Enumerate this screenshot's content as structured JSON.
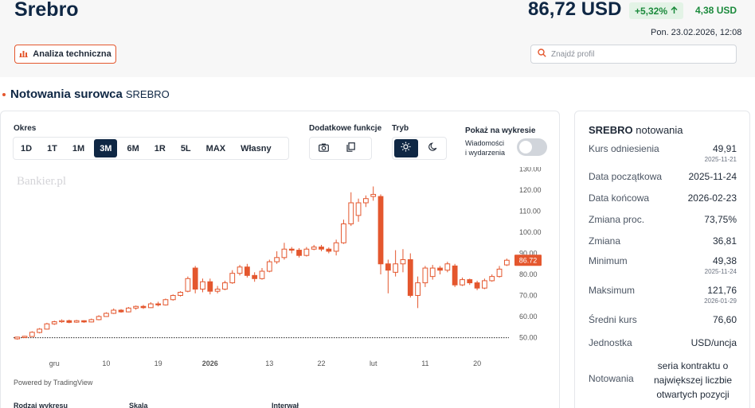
{
  "header": {
    "title": "Srebro",
    "price": "86,72 USD",
    "change_pct": "+5,32%",
    "change_abs": "4,38 USD",
    "datetime": "Pon. 23.02.2026, 12:08",
    "ta_button": "Analiza techniczna",
    "search_placeholder": "Znajdź profil"
  },
  "section": {
    "title": "Notowania surowca",
    "subtitle": "SREBRO"
  },
  "controls": {
    "period_label": "Okres",
    "periods": [
      "1D",
      "1T",
      "1M",
      "3M",
      "6M",
      "1R",
      "5L",
      "MAX",
      "Własny"
    ],
    "active_period": "3M",
    "extra_label": "Dodatkowe funkcje",
    "mode_label": "Tryb",
    "show_label": "Pokaż na wykresie",
    "show_line1": "Wiadomości",
    "show_line2": "i wydarzenia"
  },
  "watermark": "Bankier.pl",
  "powered": "Powered by TradingView",
  "bottom_labels": [
    "Rodzaj wykresu",
    "Skala",
    "Interwał"
  ],
  "colors": {
    "accent": "#e4572e",
    "navy": "#0f2744",
    "green": "#1b8a3c"
  },
  "chart_data": {
    "type": "candlestick",
    "y_ticks": [
      50,
      60,
      70,
      80,
      90,
      100,
      110,
      120,
      130
    ],
    "y_tick_labels": [
      "50.00",
      "60.00",
      "70.00",
      "80.00",
      "90.00",
      "100.00",
      "110.00",
      "120.00",
      "130.00"
    ],
    "ylim": [
      46,
      131
    ],
    "x_ticks": [
      {
        "label": "gru",
        "i": 5
      },
      {
        "label": "10",
        "i": 12
      },
      {
        "label": "19",
        "i": 19
      },
      {
        "label": "2026",
        "i": 26
      },
      {
        "label": "13",
        "i": 34
      },
      {
        "label": "22",
        "i": 41
      },
      {
        "label": "lut",
        "i": 48
      },
      {
        "label": "11",
        "i": 55
      },
      {
        "label": "20",
        "i": 62
      }
    ],
    "last_price_label": "86.72",
    "last_price": 86.72,
    "base_line": 49.91,
    "candles": [
      [
        49.4,
        50.2,
        49.0,
        50.4
      ],
      [
        50.0,
        50.6,
        49.8,
        50.8
      ],
      [
        50.5,
        52.5,
        50.3,
        53.0
      ],
      [
        52.4,
        54.0,
        52.0,
        54.5
      ],
      [
        54.0,
        56.5,
        53.8,
        57.0
      ],
      [
        56.5,
        57.5,
        56.0,
        58.0
      ],
      [
        57.5,
        58.0,
        57.0,
        58.6
      ],
      [
        58.0,
        57.2,
        56.8,
        58.5
      ],
      [
        57.3,
        58.0,
        57.0,
        58.4
      ],
      [
        58.0,
        57.4,
        57.0,
        58.2
      ],
      [
        57.4,
        58.5,
        57.2,
        59.0
      ],
      [
        58.5,
        60.0,
        58.2,
        60.6
      ],
      [
        60.0,
        61.5,
        59.8,
        62.0
      ],
      [
        61.5,
        63.0,
        61.2,
        63.8
      ],
      [
        63.0,
        62.2,
        61.8,
        63.5
      ],
      [
        62.2,
        64.0,
        62.0,
        64.5
      ],
      [
        64.0,
        64.8,
        63.2,
        65.2
      ],
      [
        64.8,
        64.2,
        63.6,
        65.5
      ],
      [
        64.2,
        66.0,
        64.0,
        66.8
      ],
      [
        66.0,
        65.5,
        64.8,
        67.0
      ],
      [
        65.5,
        68.0,
        65.2,
        68.5
      ],
      [
        68.0,
        70.0,
        67.5,
        70.5
      ],
      [
        70.0,
        71.5,
        69.5,
        72.0
      ],
      [
        72.0,
        78.0,
        71.5,
        79.0
      ],
      [
        83.0,
        73.0,
        71.0,
        84.0
      ],
      [
        73.0,
        76.5,
        71.5,
        78.0
      ],
      [
        76.5,
        72.0,
        70.5,
        78.0
      ],
      [
        72.0,
        73.0,
        71.0,
        74.5
      ],
      [
        73.0,
        76.0,
        72.5,
        77.0
      ],
      [
        76.0,
        80.5,
        75.5,
        82.0
      ],
      [
        80.5,
        83.5,
        79.5,
        84.5
      ],
      [
        83.5,
        79.5,
        78.5,
        85.0
      ],
      [
        79.5,
        78.0,
        76.5,
        81.0
      ],
      [
        78.0,
        81.5,
        77.5,
        83.0
      ],
      [
        81.5,
        86.0,
        81.0,
        87.0
      ],
      [
        86.0,
        88.0,
        85.0,
        91.0
      ],
      [
        88.0,
        92.0,
        87.0,
        95.0
      ],
      [
        92.0,
        91.5,
        90.0,
        93.0
      ],
      [
        91.5,
        89.0,
        88.0,
        92.5
      ],
      [
        89.0,
        92.0,
        88.5,
        93.0
      ],
      [
        92.0,
        93.0,
        91.5,
        94.0
      ],
      [
        93.0,
        92.0,
        91.0,
        94.0
      ],
      [
        92.0,
        91.0,
        90.0,
        92.8
      ],
      [
        91.0,
        95.0,
        89.0,
        96.5
      ],
      [
        95.0,
        104.0,
        94.5,
        106.0
      ],
      [
        104.0,
        114.0,
        103.0,
        119.0
      ],
      [
        108.0,
        114.0,
        105.0,
        116.0
      ],
      [
        114.0,
        116.0,
        112.0,
        117.5
      ],
      [
        117.0,
        118.0,
        115.0,
        121.76
      ],
      [
        117.0,
        85.0,
        80.0,
        118.0
      ],
      [
        85.0,
        82.0,
        71.0,
        87.0
      ],
      [
        81.0,
        85.0,
        79.0,
        91.5
      ],
      [
        85.0,
        87.0,
        81.0,
        92.0
      ],
      [
        87.0,
        70.0,
        69.0,
        90.0
      ],
      [
        70.0,
        76.0,
        64.0,
        79.0
      ],
      [
        76.0,
        83.0,
        74.0,
        84.0
      ],
      [
        79.0,
        83.0,
        77.5,
        84.5
      ],
      [
        83.0,
        82.0,
        80.0,
        84.0
      ],
      [
        82.0,
        85.0,
        81.0,
        86.0
      ],
      [
        84.0,
        75.0,
        74.0,
        85.0
      ],
      [
        75.0,
        77.5,
        74.5,
        78.5
      ],
      [
        77.5,
        76.0,
        75.0,
        78.0
      ],
      [
        76.0,
        73.5,
        72.5,
        77.0
      ],
      [
        73.5,
        77.0,
        73.0,
        78.0
      ],
      [
        77.0,
        79.0,
        76.5,
        80.0
      ],
      [
        79.0,
        82.5,
        78.5,
        84.0
      ],
      [
        84.5,
        86.72,
        84.0,
        87.5
      ]
    ]
  },
  "side": {
    "title_bold": "SREBRO",
    "title_rest": "notowania",
    "rows": [
      {
        "label": "Kurs odniesienia",
        "value": "49,91",
        "date": "2025-11-21"
      },
      {
        "label": "Data początkowa",
        "value": "2025-11-24"
      },
      {
        "label": "Data końcowa",
        "value": "2026-02-23"
      },
      {
        "label": "Zmiana proc.",
        "value": "73,75%"
      },
      {
        "label": "Zmiana",
        "value": "36,81"
      },
      {
        "label": "Minimum",
        "value": "49,38",
        "date": "2025-11-24"
      },
      {
        "label": "Maksimum",
        "value": "121,76",
        "date": "2026-01-29"
      },
      {
        "label": "Średni kurs",
        "value": "76,60"
      },
      {
        "label": "Jednostka",
        "value": "USD/uncja"
      },
      {
        "label": "Notowania",
        "value_lines": [
          "seria kontraktu o",
          "największej liczbie",
          "otwartych pozycji"
        ]
      }
    ]
  }
}
